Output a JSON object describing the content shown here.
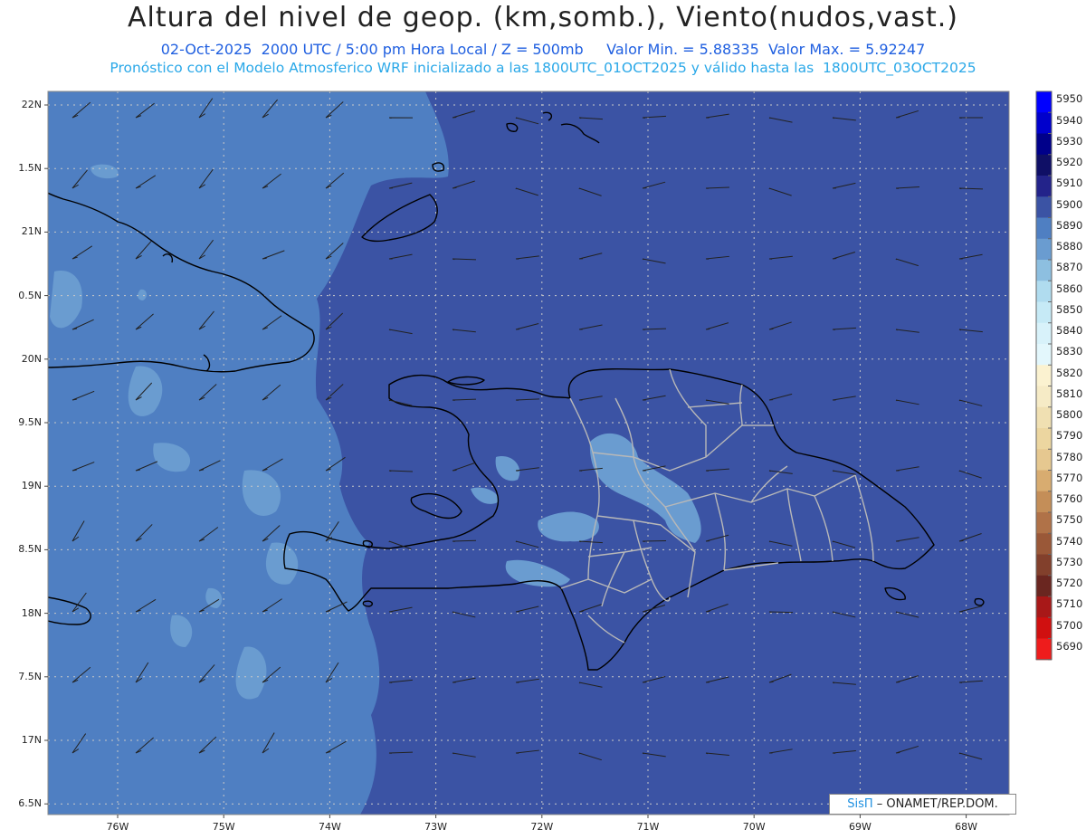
{
  "header": {
    "title": "Altura del nivel de geop. (km,somb.), Viento(nudos,vast.)",
    "line2": "02-Oct-2025  2000 UTC / 5:00 pm Hora Local / Z = 500mb     Valor Min. = 5.88335  Valor Max. = 5.92247",
    "line3": "Pronóstico con el Modelo Atmosferico WRF inicializado a las 1800UTC_01OCT2025 y válido hasta las  1800UTC_03OCT2025"
  },
  "axes": {
    "lat_labels": [
      "22N",
      "1.5N",
      "21N",
      "0.5N",
      "20N",
      "9.5N",
      "19N",
      "8.5N",
      "18N",
      "7.5N",
      "17N",
      "6.5N"
    ],
    "lon_labels": [
      "76W",
      "75W",
      "74W",
      "73W",
      "72W",
      "71W",
      "70W",
      "69W",
      "68W"
    ]
  },
  "colorbar": {
    "levels": [
      "5950",
      "5940",
      "5930",
      "5920",
      "5910",
      "5900",
      "5890",
      "5880",
      "5870",
      "5860",
      "5850",
      "5840",
      "5830",
      "5820",
      "5810",
      "5800",
      "5790",
      "5780",
      "5770",
      "5760",
      "5750",
      "5740",
      "5730",
      "5720",
      "5710",
      "5700",
      "5690"
    ],
    "colors": [
      "#0000ff",
      "#0000cc",
      "#00008a",
      "#0f0f66",
      "#23238a",
      "#3b53a4",
      "#4f7fc2",
      "#6a9cd0",
      "#8dbfe0",
      "#b0dcef",
      "#c6eaf6",
      "#d8f2fa",
      "#e3f7fc",
      "#fbf2d0",
      "#f6ebc6",
      "#f0e0b2",
      "#ecd6a0",
      "#e6c890",
      "#d8ac70",
      "#c48e58",
      "#b07248",
      "#9a5838",
      "#82402c",
      "#6a2620",
      "#a81818",
      "#d01010",
      "#ee1c1c"
    ]
  },
  "map_colors": {
    "background": "#3b53a4",
    "shade_5890": "#4f7fc2",
    "shade_5880": "#6a9cd0",
    "coast": "#000000",
    "provinces": "#b8b8b8"
  },
  "credit": {
    "brand": "SisΠ",
    "text": " – ONAMET/REP.DOM."
  }
}
